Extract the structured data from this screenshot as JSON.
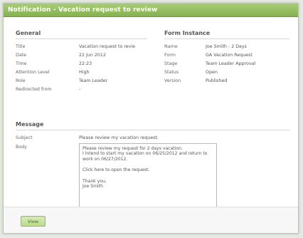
{
  "window": {
    "title": "Notification - Vacation request to review"
  },
  "general": {
    "heading": "General",
    "rows": [
      {
        "label": "Title",
        "value": "Vacation request to revie"
      },
      {
        "label": "Date",
        "value": "22 Jun 2012"
      },
      {
        "label": "Time",
        "value": "22:23"
      },
      {
        "label": "Attention Level",
        "value": "High"
      },
      {
        "label": "Role",
        "value": "Team Leader"
      },
      {
        "label": "Redirected from",
        "value": "-"
      }
    ]
  },
  "form_instance": {
    "heading": "Form Instance",
    "rows": [
      {
        "label": "Name",
        "value": "Joe Smith - 2 Days"
      },
      {
        "label": "Form",
        "value": "GA Vacation Request"
      },
      {
        "label": "Stage",
        "value": "Team Leader Approval"
      },
      {
        "label": "Status",
        "value": "Open"
      },
      {
        "label": "Version",
        "value": "Published"
      }
    ]
  },
  "message": {
    "heading": "Message",
    "subject_label": "Subject",
    "subject_value": "Please review my vacation request.",
    "body_label": "Body",
    "body_lines": [
      "Please review my request for 2 days vacation.",
      "I intend to start my vacation on 06/25/2012 and return to work on 06/27/2012.",
      "",
      "Click here to open the request.",
      "",
      "Thank you,",
      "Joe Smith"
    ]
  },
  "footer": {
    "view_label": "View"
  }
}
